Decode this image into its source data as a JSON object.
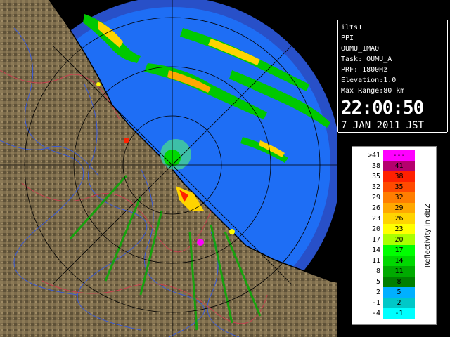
{
  "info": {
    "site": "ilts1",
    "scan_type": "PPI",
    "product": "OUMU_IMA0",
    "task": "Task: OUMU_A",
    "prf": "PRF: 1800Hz",
    "elevation": "Elevation:1.0",
    "max_range": "Max Range:80 km",
    "time": "22:00:50",
    "date": "7 JAN 2011 JST"
  },
  "legend": {
    "title": "Reflectivity in dBZ",
    "rows": [
      {
        "label": ">41",
        "value": "---",
        "color": "#ff00ff"
      },
      {
        "label": "38",
        "value": "41",
        "color": "#b5006e"
      },
      {
        "label": "35",
        "value": "38",
        "color": "#ff2000"
      },
      {
        "label": "32",
        "value": "35",
        "color": "#ff4a00"
      },
      {
        "label": "29",
        "value": "32",
        "color": "#ff7e00"
      },
      {
        "label": "26",
        "value": "29",
        "color": "#ffa800"
      },
      {
        "label": "23",
        "value": "26",
        "color": "#ffd400"
      },
      {
        "label": "20",
        "value": "23",
        "color": "#ffff00"
      },
      {
        "label": "17",
        "value": "20",
        "color": "#aaff00"
      },
      {
        "label": "14",
        "value": "17",
        "color": "#00ff00"
      },
      {
        "label": "11",
        "value": "14",
        "color": "#00d800"
      },
      {
        "label": "8",
        "value": "11",
        "color": "#00aa00"
      },
      {
        "label": "5",
        "value": "8",
        "color": "#007f00"
      },
      {
        "label": "2",
        "value": "5",
        "color": "#00b0ff"
      },
      {
        "label": "-1",
        "value": "2",
        "color": "#00c8c8"
      },
      {
        "label": "-4",
        "value": "-1",
        "color": "#00ffff"
      }
    ]
  },
  "colors": {
    "sea_inner": "#1e6ef5",
    "sea_outer": "#2850c8",
    "land": "#7a6a4a",
    "range_ring": "#000000"
  }
}
